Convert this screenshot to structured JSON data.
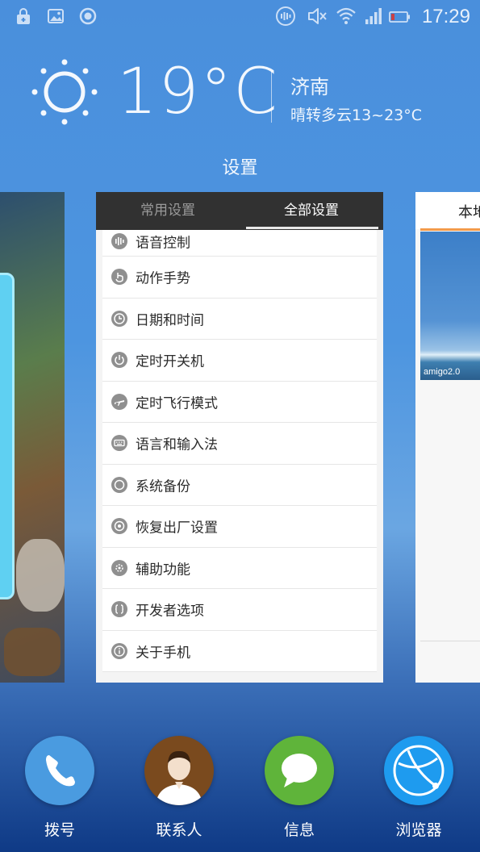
{
  "status_bar": {
    "time": "17:29",
    "left_icons": [
      "lock-icon",
      "image-icon",
      "record-icon"
    ],
    "right_icons": [
      "voice-icon",
      "mute-icon",
      "wifi-icon",
      "signal-icon",
      "battery-icon"
    ]
  },
  "weather": {
    "temperature": "19°C",
    "city": "济南",
    "forecast": "晴转多云13~23°C",
    "icon": "sun-icon"
  },
  "recent_app_title": "设置",
  "settings_card": {
    "tabs": [
      {
        "label": "常用设置",
        "active": false
      },
      {
        "label": "全部设置",
        "active": true
      }
    ],
    "items": [
      {
        "label": "语音控制",
        "icon": "voice-control-icon"
      },
      {
        "label": "动作手势",
        "icon": "gesture-icon"
      },
      {
        "label": "日期和时间",
        "icon": "clock-icon"
      },
      {
        "label": "定时开关机",
        "icon": "power-icon"
      },
      {
        "label": "定时飞行模式",
        "icon": "airplane-icon"
      },
      {
        "label": "语言和输入法",
        "icon": "keyboard-icon"
      },
      {
        "label": "系统备份",
        "icon": "backup-icon"
      },
      {
        "label": "恢复出厂设置",
        "icon": "reset-icon"
      },
      {
        "label": "辅助功能",
        "icon": "accessibility-icon"
      },
      {
        "label": "开发者选项",
        "icon": "developer-icon"
      },
      {
        "label": "关于手机",
        "icon": "info-icon"
      }
    ]
  },
  "right_card": {
    "header": "本地",
    "thumbnail_caption": "amigo2.0"
  },
  "dock": [
    {
      "label": "拨号",
      "icon": "phone-icon",
      "color": "#4a9be0"
    },
    {
      "label": "联系人",
      "icon": "contact-icon",
      "color": "#7a4a1e"
    },
    {
      "label": "信息",
      "icon": "message-icon",
      "color": "#5fb43a"
    },
    {
      "label": "浏览器",
      "icon": "browser-icon",
      "color": "#1e9bef"
    }
  ],
  "colors": {
    "tab_bar": "#313131",
    "accent_orange": "#f39a4a",
    "item_icon": "#8f8f8f"
  }
}
